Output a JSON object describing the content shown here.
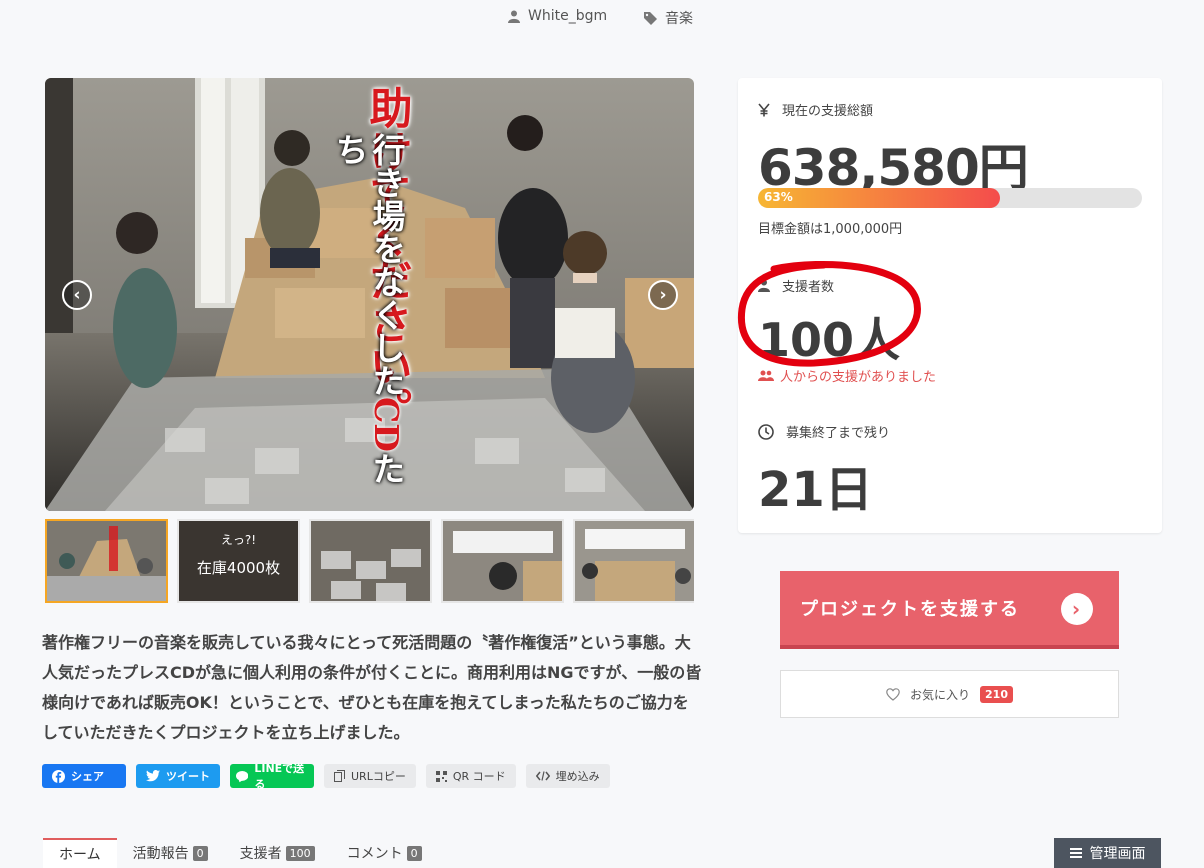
{
  "meta": {
    "author": "White_bgm",
    "category": "音楽"
  },
  "hero": {
    "title": "助けてください。",
    "subtitle_a": "行き場をなくした",
    "subtitle_cd": "CD",
    "subtitle_b": "たち",
    "prev_label": "‹",
    "next_label": "›"
  },
  "thumbnails": [
    {
      "title": "",
      "big": ""
    },
    {
      "title": "えっ?!",
      "big": "在庫4000枚"
    },
    {
      "title": "",
      "big": ""
    },
    {
      "title": "",
      "big": ""
    },
    {
      "title": "",
      "big": ""
    }
  ],
  "description": "著作権フリーの音楽を販売している我々にとって死活問題の〝著作権復活”という事態。大人気だったプレスCDが急に個人利用の条件が付くことに。商用利用はNGですが、一般の皆様向けであれば販売OK！ということで、ぜひとも在庫を抱えてしまった私たちのご協力をしていただきたくプロジェクトを立ち上げました。",
  "share": {
    "facebook": "シェア",
    "twitter": "ツイート",
    "line": "LINEで送る",
    "url_copy": "URLコピー",
    "qr": "QR コード",
    "embed": "埋め込み"
  },
  "tabs": [
    {
      "label": "ホーム",
      "count": ""
    },
    {
      "label": "活動報告",
      "count": "0"
    },
    {
      "label": "支援者",
      "count": "100"
    },
    {
      "label": "コメント",
      "count": "0"
    }
  ],
  "admin_label": "管理画面",
  "stats": {
    "total_label": "現在の支援総額",
    "total_value": "638,580円",
    "progress_text": "63%",
    "progress": 0.63,
    "goal_text": "目標金額は1,000,000円",
    "supporters_label": "支援者数",
    "supporters_value": "100人",
    "supporters_note": "人からの支援がありました",
    "remaining_label": "募集終了まで残り",
    "remaining_value": "21日"
  },
  "support_button": "プロジェクトを支援する",
  "favorite": {
    "label": "お気に入り",
    "count": "210"
  },
  "colors": {
    "accent": "#e8626b",
    "progress_start": "#f7b633",
    "progress_end": "#f44c4c",
    "annotation": "#e3000f"
  }
}
